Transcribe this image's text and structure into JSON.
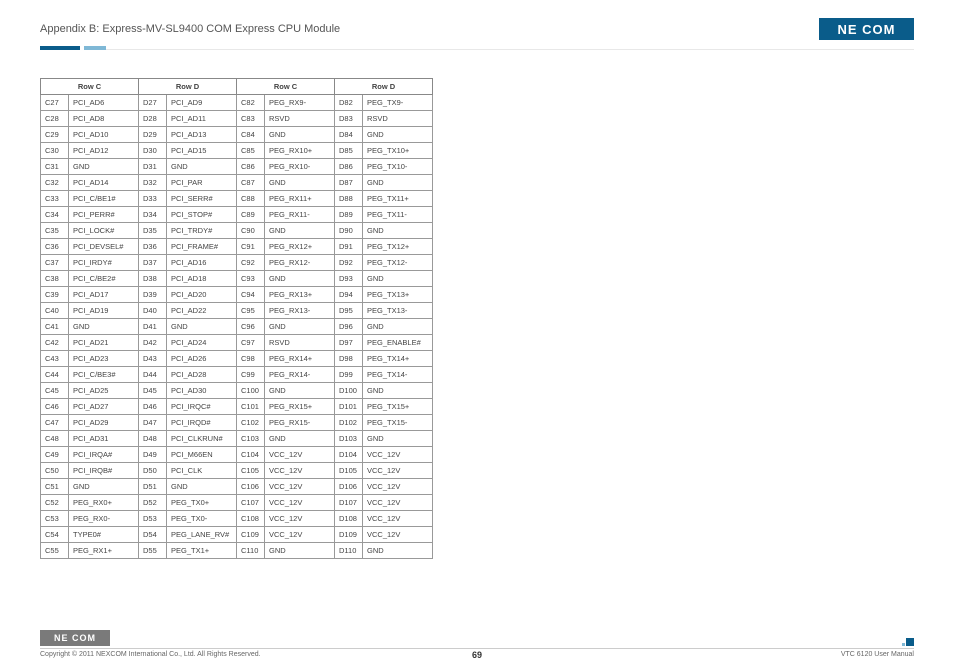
{
  "header": {
    "title": "Appendix B: Express-MV-SL9400 COM Express CPU Module",
    "logo_text": "NE COM"
  },
  "table": {
    "headers": [
      "Row C",
      "Row D",
      "Row C",
      "Row D"
    ],
    "rows": [
      [
        "C27",
        "PCI_AD6",
        "D27",
        "PCI_AD9",
        "C82",
        "PEG_RX9-",
        "D82",
        "PEG_TX9-"
      ],
      [
        "C28",
        "PCI_AD8",
        "D28",
        "PCI_AD11",
        "C83",
        "RSVD",
        "D83",
        "RSVD"
      ],
      [
        "C29",
        "PCI_AD10",
        "D29",
        "PCI_AD13",
        "C84",
        "GND",
        "D84",
        "GND"
      ],
      [
        "C30",
        "PCI_AD12",
        "D30",
        "PCI_AD15",
        "C85",
        "PEG_RX10+",
        "D85",
        "PEG_TX10+"
      ],
      [
        "C31",
        "GND",
        "D31",
        "GND",
        "C86",
        "PEG_RX10-",
        "D86",
        "PEG_TX10-"
      ],
      [
        "C32",
        "PCI_AD14",
        "D32",
        "PCI_PAR",
        "C87",
        "GND",
        "D87",
        "GND"
      ],
      [
        "C33",
        "PCI_C/BE1#",
        "D33",
        "PCI_SERR#",
        "C88",
        "PEG_RX11+",
        "D88",
        "PEG_TX11+"
      ],
      [
        "C34",
        "PCI_PERR#",
        "D34",
        "PCI_STOP#",
        "C89",
        "PEG_RX11-",
        "D89",
        "PEG_TX11-"
      ],
      [
        "C35",
        "PCI_LOCK#",
        "D35",
        "PCI_TRDY#",
        "C90",
        "GND",
        "D90",
        "GND"
      ],
      [
        "C36",
        "PCI_DEVSEL#",
        "D36",
        "PCI_FRAME#",
        "C91",
        "PEG_RX12+",
        "D91",
        "PEG_TX12+"
      ],
      [
        "C37",
        "PCI_IRDY#",
        "D37",
        "PCI_AD16",
        "C92",
        "PEG_RX12-",
        "D92",
        "PEG_TX12-"
      ],
      [
        "C38",
        "PCI_C/BE2#",
        "D38",
        "PCI_AD18",
        "C93",
        "GND",
        "D93",
        "GND"
      ],
      [
        "C39",
        "PCI_AD17",
        "D39",
        "PCI_AD20",
        "C94",
        "PEG_RX13+",
        "D94",
        "PEG_TX13+"
      ],
      [
        "C40",
        "PCI_AD19",
        "D40",
        "PCI_AD22",
        "C95",
        "PEG_RX13-",
        "D95",
        "PEG_TX13-"
      ],
      [
        "C41",
        "GND",
        "D41",
        "GND",
        "C96",
        "GND",
        "D96",
        "GND"
      ],
      [
        "C42",
        "PCI_AD21",
        "D42",
        "PCI_AD24",
        "C97",
        "RSVD",
        "D97",
        "PEG_ENABLE#"
      ],
      [
        "C43",
        "PCI_AD23",
        "D43",
        "PCI_AD26",
        "C98",
        "PEG_RX14+",
        "D98",
        "PEG_TX14+"
      ],
      [
        "C44",
        "PCI_C/BE3#",
        "D44",
        "PCI_AD28",
        "C99",
        "PEG_RX14-",
        "D99",
        "PEG_TX14-"
      ],
      [
        "C45",
        "PCI_AD25",
        "D45",
        "PCI_AD30",
        "C100",
        "GND",
        "D100",
        "GND"
      ],
      [
        "C46",
        "PCI_AD27",
        "D46",
        "PCI_IRQC#",
        "C101",
        "PEG_RX15+",
        "D101",
        "PEG_TX15+"
      ],
      [
        "C47",
        "PCI_AD29",
        "D47",
        "PCI_IRQD#",
        "C102",
        "PEG_RX15-",
        "D102",
        "PEG_TX15-"
      ],
      [
        "C48",
        "PCI_AD31",
        "D48",
        "PCI_CLKRUN#",
        "C103",
        "GND",
        "D103",
        "GND"
      ],
      [
        "C49",
        "PCI_IRQA#",
        "D49",
        "PCI_M66EN",
        "C104",
        "VCC_12V",
        "D104",
        "VCC_12V"
      ],
      [
        "C50",
        "PCI_IRQB#",
        "D50",
        "PCI_CLK",
        "C105",
        "VCC_12V",
        "D105",
        "VCC_12V"
      ],
      [
        "C51",
        "GND",
        "D51",
        "GND",
        "C106",
        "VCC_12V",
        "D106",
        "VCC_12V"
      ],
      [
        "C52",
        "PEG_RX0+",
        "D52",
        "PEG_TX0+",
        "C107",
        "VCC_12V",
        "D107",
        "VCC_12V"
      ],
      [
        "C53",
        "PEG_RX0-",
        "D53",
        "PEG_TX0-",
        "C108",
        "VCC_12V",
        "D108",
        "VCC_12V"
      ],
      [
        "C54",
        "TYPE0#",
        "D54",
        "PEG_LANE_RV#",
        "C109",
        "VCC_12V",
        "D109",
        "VCC_12V"
      ],
      [
        "C55",
        "PEG_RX1+",
        "D55",
        "PEG_TX1+",
        "C110",
        "GND",
        "D110",
        "GND"
      ]
    ]
  },
  "footer": {
    "logo_text": "NE COM",
    "copyright": "Copyright © 2011 NEXCOM International Co., Ltd. All Rights Reserved.",
    "page_number": "69",
    "doc_ref": "VTC 6120 User Manual"
  }
}
